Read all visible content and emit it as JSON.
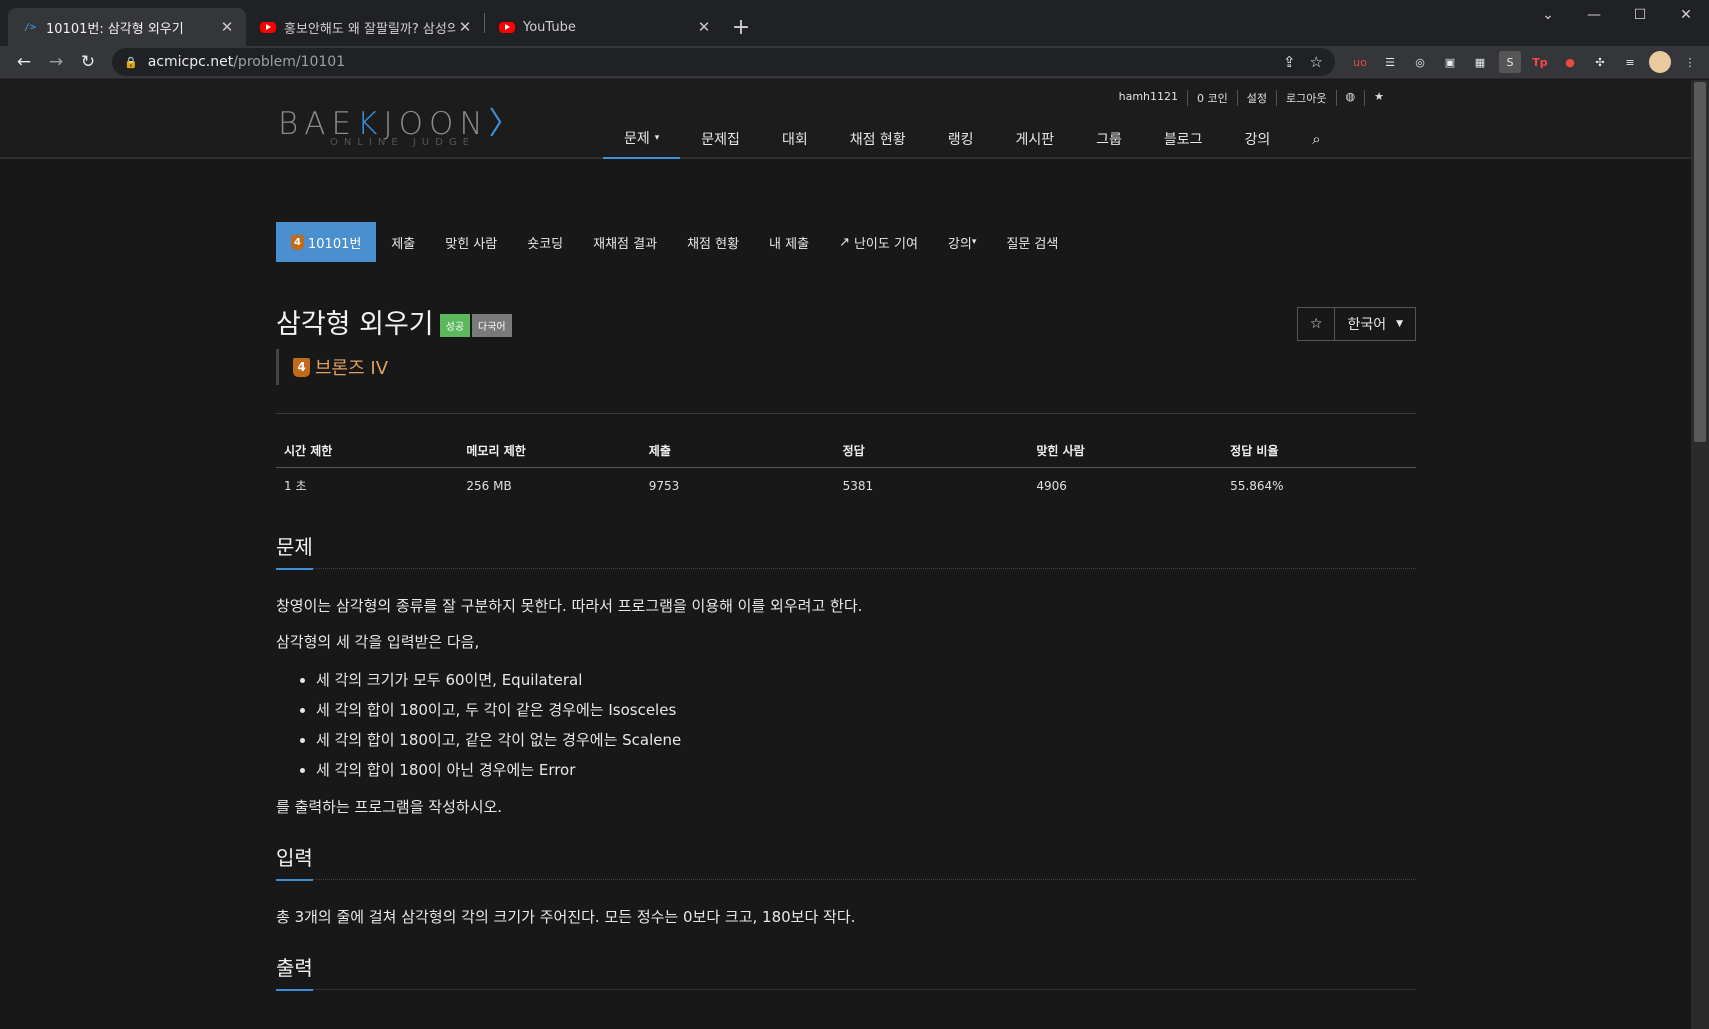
{
  "browser": {
    "tabs": [
      {
        "title": "10101번: 삼각형 외우기",
        "favicon": "bj-favicon-icon",
        "active": true
      },
      {
        "title": "홍보안해도 왜 잘팔릴까? 삼성의",
        "favicon": "youtube-icon",
        "active": false
      },
      {
        "title": "YouTube",
        "favicon": "youtube-icon",
        "active": false
      }
    ],
    "url_host": "acmicpc.net",
    "url_path": "/problem/10101"
  },
  "site": {
    "logo_main": "BAE",
    "logo_k": "K",
    "logo_rest": "JOON",
    "logo_sub": "ONLINE JUDGE",
    "top_links": [
      "hamh1121",
      "0 코인",
      "설정",
      "로그아웃"
    ],
    "nav": [
      "문제",
      "문제집",
      "대회",
      "채점 현황",
      "랭킹",
      "게시판",
      "그룹",
      "블로그",
      "강의"
    ]
  },
  "problem": {
    "subnav": [
      "10101번",
      "제출",
      "맞힌 사람",
      "숏코딩",
      "재채점 결과",
      "채점 현황",
      "내 제출",
      "난이도 기여",
      "강의",
      "질문 검색"
    ],
    "title": "삼각형 외우기",
    "labels": [
      "성공",
      "다국어"
    ],
    "tier_num": "4",
    "tier": "브론즈 IV",
    "language": "한국어",
    "info_headers": [
      "시간 제한",
      "메모리 제한",
      "제출",
      "정답",
      "맞힌 사람",
      "정답 비율"
    ],
    "info_values": [
      "1 초",
      "256 MB",
      "9753",
      "5381",
      "4906",
      "55.864%"
    ],
    "sec_problem": "문제",
    "desc_1": "창영이는 삼각형의 종류를 잘 구분하지 못한다. 따라서 프로그램을 이용해 이를 외우려고 한다.",
    "desc_2": "삼각형의 세 각을 입력받은 다음,",
    "conditions": [
      "세 각의 크기가 모두 60이면, Equilateral",
      "세 각의 합이 180이고, 두 각이 같은 경우에는 Isosceles",
      "세 각의 합이 180이고, 같은 각이 없는 경우에는 Scalene",
      "세 각의 합이 180이 아닌 경우에는 Error"
    ],
    "desc_3": "를 출력하는 프로그램을 작성하시오.",
    "sec_input": "입력",
    "input_desc": "총 3개의 줄에 걸쳐 삼각형의 각의 크기가 주어진다. 모든 정수는 0보다 크고, 180보다 작다.",
    "sec_output": "출력"
  },
  "colors": {
    "accent": "#3a8fd8",
    "success": "#5cb85c",
    "bronze": "#c06a1a"
  }
}
